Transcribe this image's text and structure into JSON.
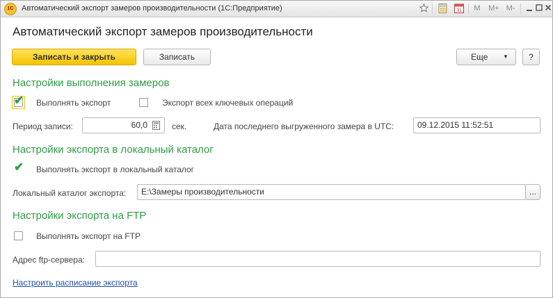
{
  "window": {
    "title": "Автоматический экспорт замеров производительности  (1С:Предприятие)",
    "toolbar_icons": [
      "favorite-icon",
      "calculator-icon",
      "calendar-icon"
    ],
    "memory_buttons": [
      "M",
      "M+",
      "M-"
    ],
    "calendar_day": "31"
  },
  "form": {
    "title": "Автоматический экспорт замеров производительности"
  },
  "toolbar": {
    "save_close_label": "Записать и закрыть",
    "save_label": "Записать",
    "more_label": "Еще",
    "help_label": "?"
  },
  "section_execution": {
    "header": "Настройки выполнения замеров",
    "do_export_label": "Выполнять экспорт",
    "do_export_checked": true,
    "all_key_ops_label": "Экспорт всех ключевых операций",
    "all_key_ops_checked": false,
    "period_label": "Период записи:",
    "period_value": "60,0",
    "period_unit": "сек.",
    "last_export_label": "Дата последнего выгруженного замера в UTC:",
    "last_export_value": "09.12.2015 11:52:51"
  },
  "section_local": {
    "header": "Настройки экспорта в локальный каталог",
    "do_local_label": "Выполнять экспорт в локальный каталог",
    "do_local_checked": true,
    "catalog_label": "Локальный каталог экспорта:",
    "catalog_value": "E:\\Замеры производительности",
    "browse_label": "..."
  },
  "section_ftp": {
    "header": "Настройки экспорта на FTP",
    "do_ftp_label": "Выполнять экспорт на FTP",
    "do_ftp_checked": false,
    "address_label": "Адрес ftp-сервера:",
    "address_value": ""
  },
  "schedule_link": "Настроить расписание экспорта",
  "colors": {
    "accent_green": "#2e9c47",
    "primary_yellow": "#f4c400",
    "link_blue": "#1f4fa6"
  }
}
